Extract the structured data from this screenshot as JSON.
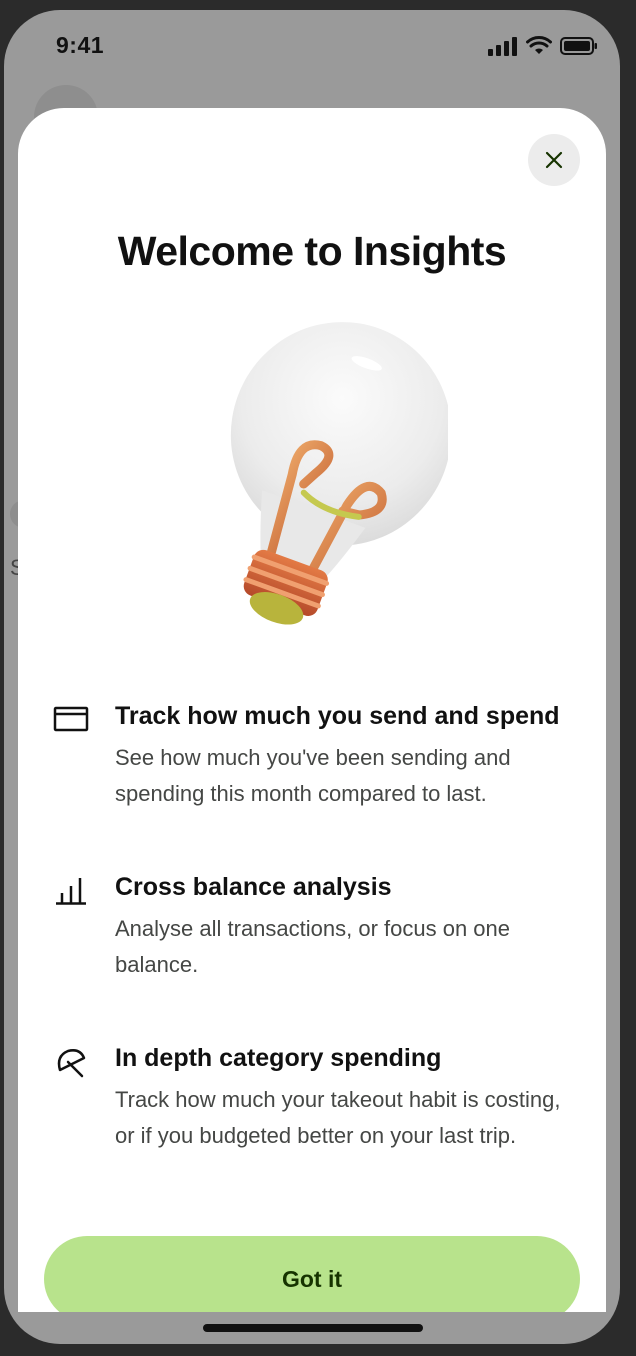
{
  "status_bar": {
    "time": "9:41"
  },
  "background": {
    "partial_letter": "S"
  },
  "modal": {
    "title": "Welcome to Insights",
    "close_icon": "close-icon",
    "features": [
      {
        "icon": "card-icon",
        "title": "Track how much you send and spend",
        "description": "See how much you've been sending and spending this month compared to last."
      },
      {
        "icon": "bar-chart-icon",
        "title": "Cross balance analysis",
        "description": "Analyse all transactions, or focus on one balance."
      },
      {
        "icon": "umbrella-icon",
        "title": "In depth category spending",
        "description": "Track how much your takeout habit is costing, or if you budgeted better on your last trip."
      }
    ],
    "cta_label": "Got it"
  },
  "colors": {
    "cta_bg": "#b8e38c",
    "cta_text": "#163300",
    "scrim": "#9a9a9a"
  }
}
